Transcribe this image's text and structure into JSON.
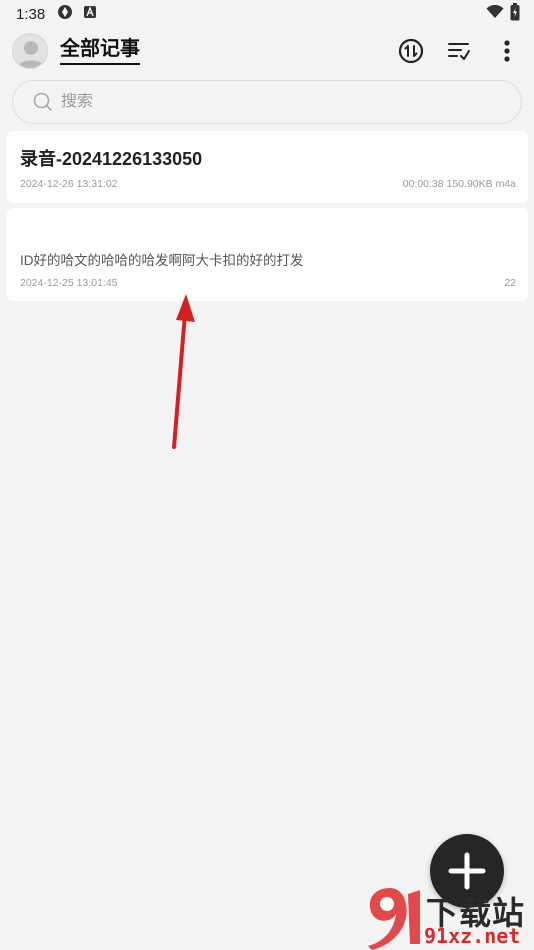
{
  "status_bar": {
    "time": "1:38",
    "icons_left": [
      "sync-icon",
      "keyboard-a-icon"
    ],
    "icons_right": [
      "wifi-icon",
      "battery-icon"
    ]
  },
  "header": {
    "title": "全部记事",
    "actions": [
      "sort-icon",
      "list-filter-icon",
      "more-vert-icon"
    ]
  },
  "search": {
    "placeholder": "搜索",
    "value": ""
  },
  "notes": [
    {
      "title": "录音-20241226133050",
      "body": "",
      "date": "2024-12-26 13:31:02",
      "meta": "00:00:38 150.90KB m4a"
    },
    {
      "title": "",
      "body": "ID好的哈文的哈哈的哈发啊阿大卡扣的好的打发",
      "date": "2024-12-25 13:01:45",
      "meta": "22"
    }
  ],
  "fab": {
    "icon": "plus-icon"
  },
  "watermark": {
    "logo_text": "下载站",
    "url_text": "91xz.net"
  },
  "colors": {
    "background": "#f3f3f3",
    "card": "#ffffff",
    "fab": "#262626",
    "annotation_arrow": "#d42020",
    "watermark_red": "#d82b2b"
  }
}
